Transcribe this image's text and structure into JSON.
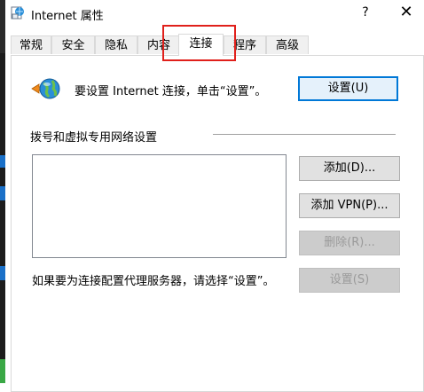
{
  "window": {
    "title": "Internet 属性"
  },
  "titlebar": {
    "help": "?",
    "close": "✕"
  },
  "tabs": [
    {
      "label": "常规"
    },
    {
      "label": "安全"
    },
    {
      "label": "隐私"
    },
    {
      "label": "内容"
    },
    {
      "label": "连接",
      "active": true
    },
    {
      "label": "程序"
    },
    {
      "label": "高级"
    }
  ],
  "connection": {
    "setup_text": "要设置 Internet 连接，单击“设置”。",
    "setup_button": "设置(U)"
  },
  "dialup": {
    "section_label": "拨号和虚拟专用网络设置",
    "add_button": "添加(D)...",
    "add_vpn_button": "添加 VPN(P)...",
    "delete_button": "删除(R)...",
    "settings_button": "设置(S)",
    "proxy_text": "如果要为连接配置代理服务器，请选择“设置”。"
  },
  "colors": {
    "highlight": "#e0201b",
    "focus_border": "#0078d7"
  }
}
